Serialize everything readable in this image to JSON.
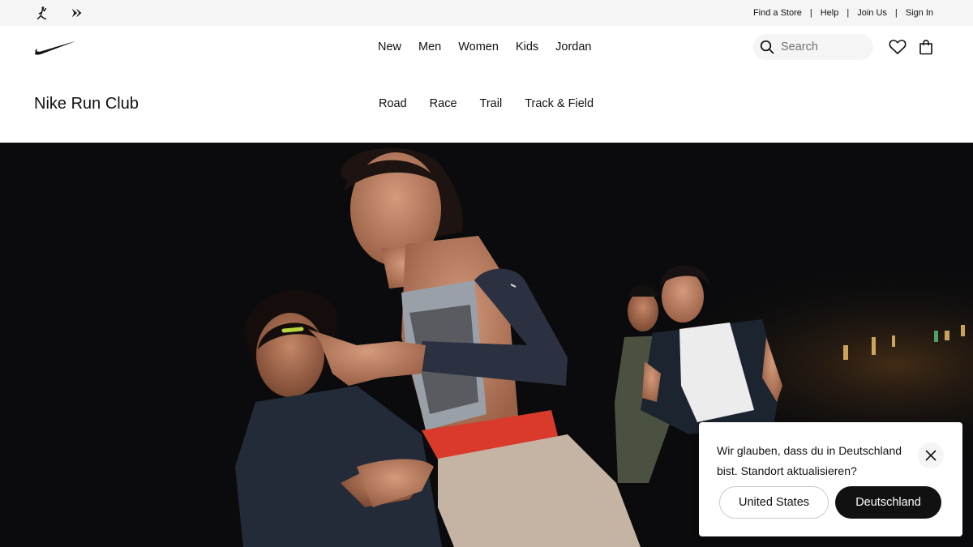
{
  "utility": {
    "icons": [
      "jordan-jumpman-icon",
      "converse-logo-icon"
    ],
    "links": [
      "Find a Store",
      "Help",
      "Join Us",
      "Sign In"
    ],
    "separator": "|"
  },
  "nav": {
    "logo": "nike-swoosh-icon",
    "links": [
      "New",
      "Men",
      "Women",
      "Kids",
      "Jordan"
    ],
    "search_placeholder": "Search"
  },
  "subnav": {
    "title": "Nike Run Club",
    "links": [
      "Road",
      "Race",
      "Trail",
      "Track & Field"
    ]
  },
  "hero": {
    "image": "group-of-runners-at-night-photo"
  },
  "location_popup": {
    "message": "Wir glauben, dass du in Deutschland bist. Standort aktualisieren?",
    "btn_stay": "United States",
    "btn_switch": "Deutschland"
  },
  "colors": {
    "utility_bg": "#f5f5f5",
    "text": "#111111",
    "primary_button": "#111111"
  }
}
